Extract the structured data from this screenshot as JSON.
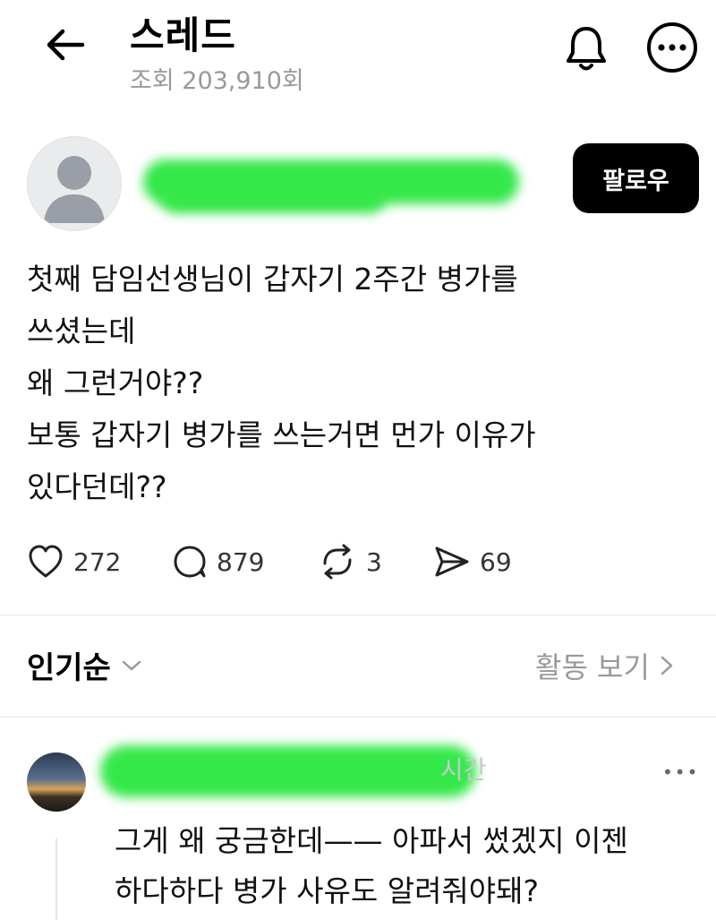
{
  "header": {
    "title": "스레드",
    "views": "조회 203,910회"
  },
  "post": {
    "follow_label": "팔로우",
    "lines": [
      "첫째 담임선생님이 갑자기 2주간 병가를",
      "쓰셨는데",
      "왜 그런거야??",
      "보통 갑자기 병가를 쓰는거면 먼가 이유가",
      "있다던데??"
    ],
    "stats": {
      "likes": "272",
      "comments": "879",
      "reposts": "3",
      "shares": "69"
    }
  },
  "sort": {
    "label": "인기순",
    "activity_label": "활동 보기"
  },
  "comment": {
    "time_partial": "시간",
    "more": "•••",
    "lines": [
      "그게 왜 궁금한데—— 아파서 썼겠지 이젠",
      "하다하다 병가 사유도 알려줘야돼?"
    ]
  },
  "colors": {
    "redaction": "#35e84a",
    "muted": "#999999",
    "follow_bg": "#000000"
  },
  "icons": [
    "back-arrow-icon",
    "bell-icon",
    "more-icon",
    "heart-icon",
    "comment-icon",
    "repost-icon",
    "share-icon",
    "chevron-down-icon",
    "chevron-right-icon"
  ]
}
